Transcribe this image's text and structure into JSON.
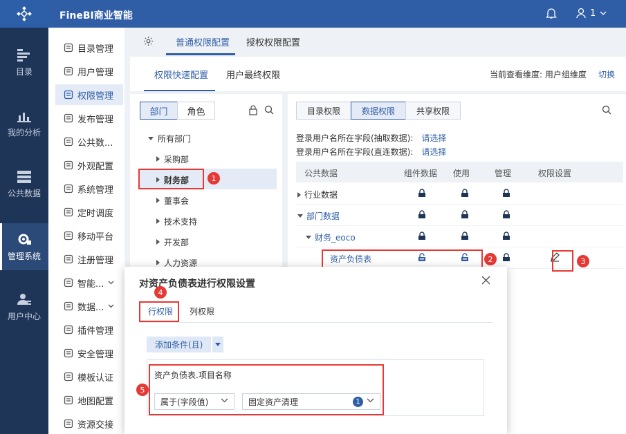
{
  "app": {
    "brand": "FineBI商业智能",
    "user": "1"
  },
  "leftnav": [
    {
      "label": "目录",
      "icon": "catalog-icon"
    },
    {
      "label": "我的分析",
      "icon": "analysis-icon"
    },
    {
      "label": "公共数据",
      "icon": "public-data-icon"
    },
    {
      "label": "管理系统",
      "icon": "system-gear-icon",
      "active": true
    },
    {
      "label": "用户中心",
      "icon": "user-center-icon"
    }
  ],
  "menu": [
    {
      "label": "目录管理",
      "icon": "catalog-manage-icon"
    },
    {
      "label": "用户管理",
      "icon": "user-manage-icon"
    },
    {
      "label": "权限管理",
      "icon": "permission-icon",
      "active": true
    },
    {
      "label": "发布管理",
      "icon": "publish-icon"
    },
    {
      "label": "公共数...",
      "icon": "public-data-icon"
    },
    {
      "label": "外观配置",
      "icon": "appearance-icon"
    },
    {
      "label": "系统管理",
      "icon": "system-icon"
    },
    {
      "label": "定时调度",
      "icon": "schedule-icon"
    },
    {
      "label": "移动平台",
      "icon": "mobile-icon"
    },
    {
      "label": "注册管理",
      "icon": "register-icon"
    },
    {
      "label": "智能...",
      "icon": "smart-icon",
      "chevron": true
    },
    {
      "label": "数据...",
      "icon": "data-icon",
      "chevron": true
    },
    {
      "label": "插件管理",
      "icon": "plugin-icon"
    },
    {
      "label": "安全管理",
      "icon": "security-icon"
    },
    {
      "label": "模板认证",
      "icon": "template-icon"
    },
    {
      "label": "地图配置",
      "icon": "map-icon"
    },
    {
      "label": "资源交接",
      "icon": "resource-icon"
    }
  ],
  "tabs1": {
    "general": "普通权限配置",
    "grant": "授权权限配置"
  },
  "tabs2": {
    "quick": "权限快速配置",
    "final": "用户最终权限"
  },
  "dimension": {
    "label": "当前查看维度: 用户组维度",
    "switch": "切换"
  },
  "deptpanel": {
    "seg_dept": "部门",
    "seg_role": "角色",
    "tree": [
      {
        "label": "所有部门",
        "level": 0,
        "expanded": true
      },
      {
        "label": "采购部",
        "level": 1
      },
      {
        "label": "财务部",
        "level": 1,
        "selected": true
      },
      {
        "label": "董事会",
        "level": 1
      },
      {
        "label": "技术支持",
        "level": 1
      },
      {
        "label": "开发部",
        "level": 1
      },
      {
        "label": "人力资源",
        "level": 1
      }
    ]
  },
  "datapanel": {
    "seg_catalog": "目录权限",
    "seg_data": "数据权限",
    "seg_share": "共享权限",
    "login_extract": "登录用户名所在字段(抽取数据):",
    "login_direct": "登录用户名所在字段(直连数据):",
    "select_link": "请选择",
    "headers": [
      "公共数据",
      "组件数据",
      "使用",
      "管理",
      "权限设置"
    ],
    "rows": [
      {
        "label": "行业数据",
        "level": 0,
        "arrow": "right"
      },
      {
        "label": "部门数据",
        "level": 0,
        "arrow": "down",
        "blue": true
      },
      {
        "label": "财务_eoco",
        "level": 1,
        "arrow": "down",
        "blue": true
      },
      {
        "label": "资产负债表",
        "level": 2,
        "blue": true,
        "unlocked": true,
        "edit": true
      }
    ]
  },
  "annotations": [
    "1",
    "2",
    "3",
    "4",
    "5"
  ],
  "modal": {
    "title": "对资产负债表进行权限设置",
    "tab_row": "行权限",
    "tab_col": "列权限",
    "add_condition": "添加条件(且)",
    "field": "资产负债表.项目名称",
    "operator": "属于(字段值)",
    "value": "固定资产清理",
    "value_count": "1"
  },
  "colors": {
    "primary": "#2f5ea6",
    "nav": "#1f3557",
    "annotation": "#e53935"
  }
}
